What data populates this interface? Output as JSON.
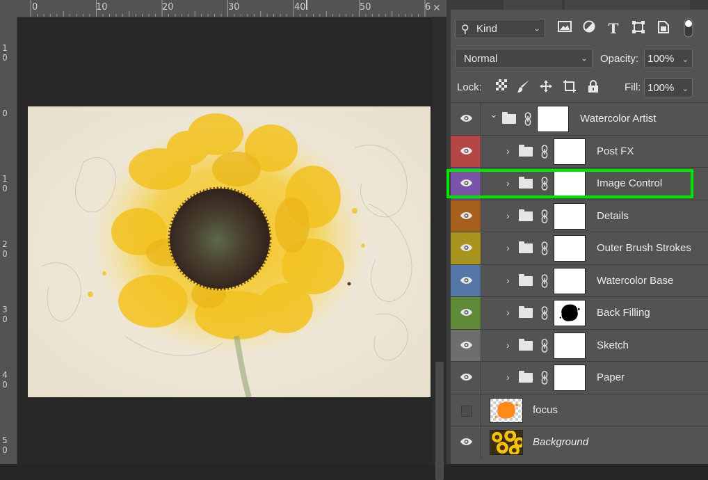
{
  "ruler": {
    "top_labels": [
      "0",
      "10",
      "20",
      "30",
      "40",
      "50",
      "6"
    ],
    "left_labels": [
      "1\n0",
      "0",
      "1\n0",
      "2\n0",
      "3\n0",
      "4\n0",
      "5\n0"
    ]
  },
  "filter": {
    "kind_label": "Kind"
  },
  "blend": {
    "mode": "Normal",
    "opacity_label": "Opacity:",
    "opacity_value": "100%",
    "lock_label": "Lock:",
    "fill_label": "Fill:",
    "fill_value": "100%"
  },
  "colors": {
    "highlight": "#00e600",
    "label_red": "#b54646",
    "label_violet": "#7a52a8",
    "label_orange": "#a8601e",
    "label_yellow": "#a8941e",
    "label_blue": "#5577a8",
    "label_green": "#5f8a3a",
    "label_gray": "#6e6e6e"
  },
  "layers": [
    {
      "name": "Watercolor Artist",
      "type": "group-open",
      "indent": 0,
      "eye": true,
      "label_color": ""
    },
    {
      "name": "Post FX",
      "type": "group",
      "indent": 1,
      "eye": true,
      "label_color": "#b54646"
    },
    {
      "name": "Image Control",
      "type": "group",
      "indent": 1,
      "eye": true,
      "label_color": "#7a52a8",
      "highlighted": true
    },
    {
      "name": "Details",
      "type": "group",
      "indent": 1,
      "eye": true,
      "label_color": "#a8601e"
    },
    {
      "name": "Outer Brush Strokes",
      "type": "group",
      "indent": 1,
      "eye": true,
      "label_color": "#a8941e"
    },
    {
      "name": "Watercolor Base",
      "type": "group",
      "indent": 1,
      "eye": true,
      "label_color": "#5577a8"
    },
    {
      "name": "Back Filling",
      "type": "group",
      "indent": 1,
      "eye": true,
      "label_color": "#5f8a3a",
      "mask": "blob"
    },
    {
      "name": "Sketch",
      "type": "group",
      "indent": 1,
      "eye": true,
      "label_color": "#6e6e6e"
    },
    {
      "name": "Paper",
      "type": "group",
      "indent": 1,
      "eye": true,
      "label_color": ""
    },
    {
      "name": "focus",
      "type": "layer",
      "indent": 0,
      "eye": false,
      "label_color": "",
      "thumb": "focus"
    },
    {
      "name": "Background",
      "type": "layer",
      "indent": 0,
      "eye": true,
      "label_color": "",
      "thumb": "sunflowers",
      "italic": true
    }
  ]
}
